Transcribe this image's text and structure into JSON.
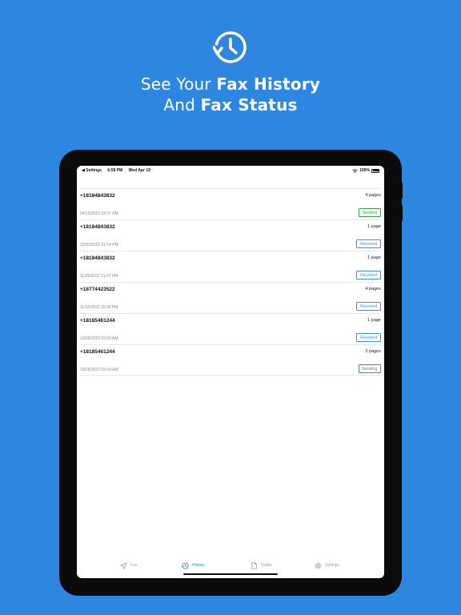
{
  "hero": {
    "icon": "clock-history-icon",
    "line1_plain": "See Your",
    "line1_bold": "Fax History",
    "line2_plain": "And",
    "line2_bold": "Fax Status"
  },
  "colors": {
    "background": "#2d86df",
    "sending": "#3aa04a",
    "received": "#3a92d8",
    "active_tab": "#2d86df"
  },
  "status_bar": {
    "back_label": "◀ Settings",
    "time": "6:58 PM",
    "date": "Wed Apr 19",
    "battery": "100%"
  },
  "fax_list": [
    {
      "number": "+18184843832",
      "pages": "4 pages",
      "date": "04/19/2023 18:57 PM",
      "status": "Sending"
    },
    {
      "number": "+18184843832",
      "pages": "1 page",
      "date": "12/01/2022 22:14 PM",
      "status": "Received"
    },
    {
      "number": "+18184843832",
      "pages": "1 page",
      "date": "11/25/2022 21:37 PM",
      "status": "Received"
    },
    {
      "number": "+18774423522",
      "pages": "4 pages",
      "date": "11/15/2022 15:26 PM",
      "status": "Received"
    },
    {
      "number": "+18185461244",
      "pages": "1 page",
      "date": "10/26/2022 09:59 AM",
      "status": "Received"
    },
    {
      "number": "+18185461244",
      "pages": "2 pages",
      "date": "10/26/2022 09:54 AM",
      "status": "Sending"
    }
  ],
  "tabs": [
    {
      "label": "Fax",
      "icon": "send-icon",
      "active": false
    },
    {
      "label": "History",
      "icon": "history-icon",
      "active": true
    },
    {
      "label": "Drafts",
      "icon": "document-icon",
      "active": false
    },
    {
      "label": "Settings",
      "icon": "gear-icon",
      "active": false
    }
  ]
}
